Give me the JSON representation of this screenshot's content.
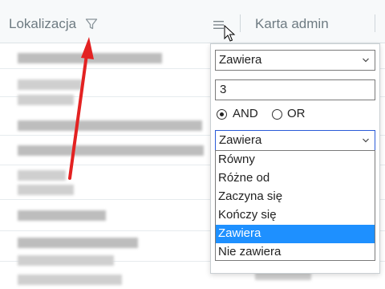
{
  "header": {
    "col1_title": "Lokalizacja",
    "col2_title": "Karta admin"
  },
  "filter_popup": {
    "condition1": "Zawiera",
    "value1": "3",
    "logic_options": [
      "AND",
      "OR"
    ],
    "logic_selected": "AND",
    "condition2": "Zawiera",
    "condition_options": [
      "Równy",
      "Różne od",
      "Zaczyna się",
      "Kończy się",
      "Zawiera",
      "Nie zawiera"
    ],
    "highlighted_option": "Zawiera"
  },
  "icons": {
    "filter": "filter-icon",
    "menu": "menu-icon",
    "chevron": "chevron-down-icon"
  },
  "colors": {
    "highlight": "#1e90ff",
    "annotation_arrow": "#e32222"
  }
}
